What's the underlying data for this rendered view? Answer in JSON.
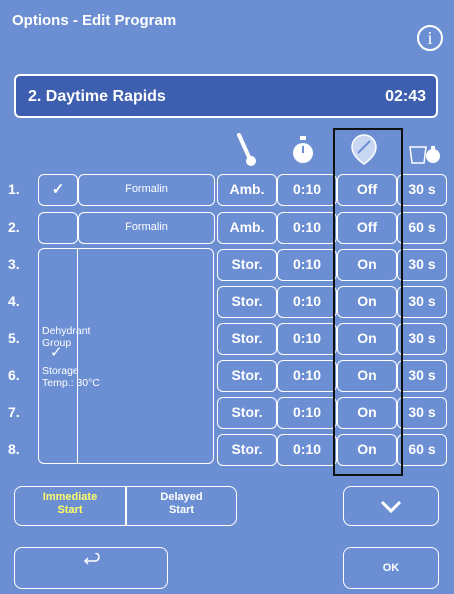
{
  "header": {
    "title": "Options - Edit Program",
    "info_label": "i"
  },
  "program": {
    "name": "2. Daytime Rapids",
    "time": "02:43"
  },
  "columns": {
    "temperature_icon": "thermometer-icon",
    "time_icon": "stopwatch-icon",
    "pv_icon": "pressure-vacuum-icon",
    "drain_icon": "drain-time-icon"
  },
  "rows": [
    {
      "num": "1.",
      "reagent": "Formalin",
      "checked": "✓",
      "temp": "Amb.",
      "time": "0:10",
      "pv": "Off",
      "drain": "30 s"
    },
    {
      "num": "2.",
      "reagent": "Formalin",
      "checked": "",
      "temp": "Amb.",
      "time": "0:10",
      "pv": "Off",
      "drain": "60 s"
    },
    {
      "num": "3.",
      "temp": "Stor.",
      "time": "0:10",
      "pv": "On",
      "drain": "30 s"
    },
    {
      "num": "4.",
      "temp": "Stor.",
      "time": "0:10",
      "pv": "On",
      "drain": "30 s"
    },
    {
      "num": "5.",
      "temp": "Stor.",
      "time": "0:10",
      "pv": "On",
      "drain": "30 s"
    },
    {
      "num": "6.",
      "temp": "Stor.",
      "time": "0:10",
      "pv": "On",
      "drain": "30 s"
    },
    {
      "num": "7.",
      "temp": "Stor.",
      "time": "0:10",
      "pv": "On",
      "drain": "30 s"
    },
    {
      "num": "8.",
      "temp": "Stor.",
      "time": "0:10",
      "pv": "On",
      "drain": "60 s"
    }
  ],
  "group": {
    "name": "Dehydrant\nGroup",
    "storage": "Storage\nTemp.: 30°C",
    "check": "✓"
  },
  "start": {
    "immediate": "Immediate\nStart",
    "delayed": "Delayed\nStart"
  },
  "buttons": {
    "scroll_down": "∨",
    "back_icon": "undo-arrow-icon",
    "ok": "OK"
  },
  "colors": {
    "background": "#6c8fd3",
    "header_bar": "#3e5fb0",
    "selected_text": "#ffff66",
    "highlight_border": "#111111"
  }
}
